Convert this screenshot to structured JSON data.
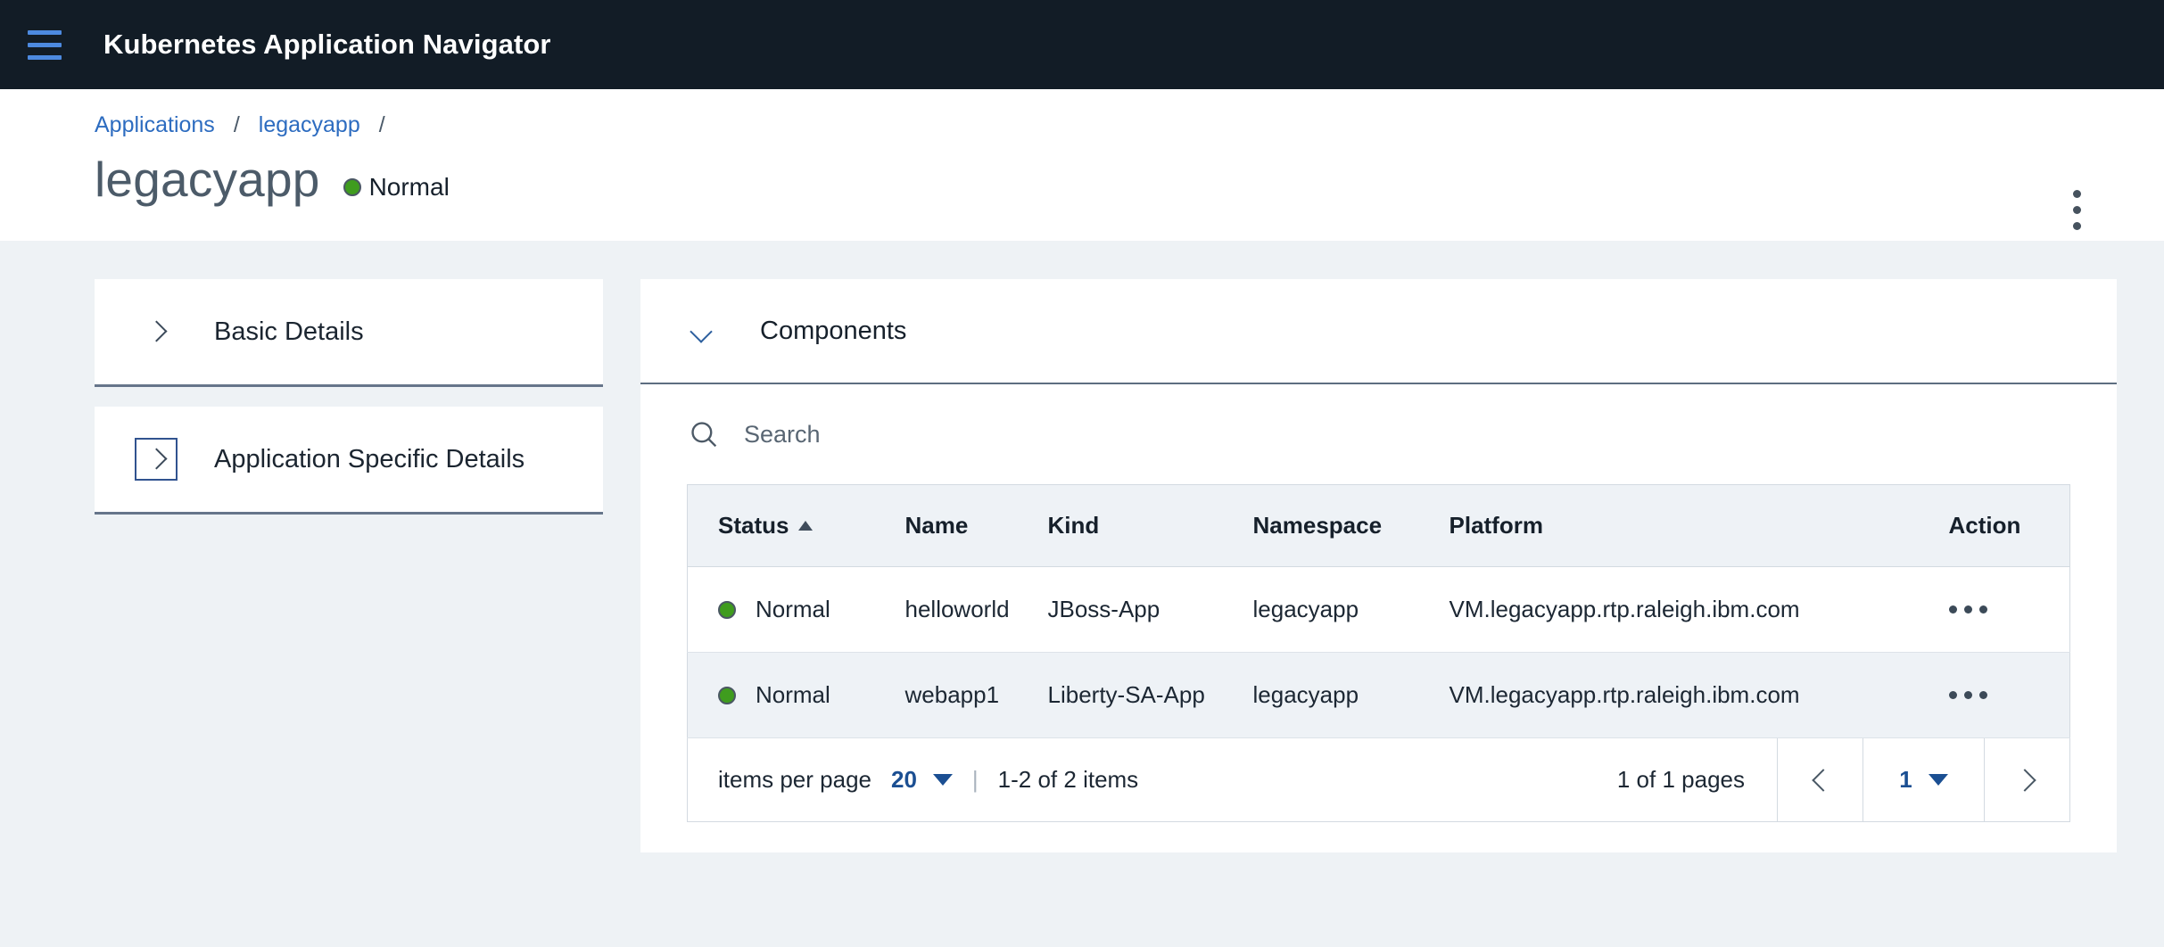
{
  "appbar": {
    "menu_icon": "hamburger-menu-icon",
    "title": "Kubernetes Application Navigator"
  },
  "breadcrumb": {
    "items": [
      {
        "label": "Applications"
      },
      {
        "label": "legacyapp"
      }
    ],
    "separator": "/",
    "trailing_separator": "/"
  },
  "page": {
    "title": "legacyapp",
    "status": "Normal",
    "status_color": "#3f9c1e",
    "overflow_menu_icon": "overflow-vertical-icon"
  },
  "accordion": {
    "items": [
      {
        "label": "Basic Details",
        "icon": "chevron-right-icon",
        "expanded": false,
        "focused": false
      },
      {
        "label": "Application Specific Details",
        "icon": "chevron-right-icon",
        "expanded": false,
        "focused": true
      }
    ]
  },
  "components_panel": {
    "title": "Components",
    "icon": "chevron-down-icon",
    "search": {
      "placeholder": "Search",
      "value": "",
      "icon": "search-icon"
    },
    "table": {
      "columns": [
        "Status",
        "Name",
        "Kind",
        "Namespace",
        "Platform",
        "Action"
      ],
      "sort_column": "Status",
      "sort_direction": "ascending",
      "rows": [
        {
          "status": "Normal",
          "status_color": "#3f9c1e",
          "name": "helloworld",
          "kind": "JBoss-App",
          "namespace": "legacyapp",
          "platform": "VM.legacyapp.rtp.raleigh.ibm.com",
          "action_icon": "overflow-horizontal-icon"
        },
        {
          "status": "Normal",
          "status_color": "#3f9c1e",
          "name": "webapp1",
          "kind": "Liberty-SA-App",
          "namespace": "legacyapp",
          "platform": "VM.legacyapp.rtp.raleigh.ibm.com",
          "action_icon": "overflow-horizontal-icon"
        }
      ]
    },
    "pagination": {
      "items_per_page_label": "items per page",
      "items_per_page_value": "20",
      "divider": "|",
      "range_text": "1-2 of 2 items",
      "pages_text": "1 of 1 pages",
      "current_page": "1",
      "prev_icon": "chevron-left-icon",
      "next_icon": "chevron-right-icon"
    }
  }
}
